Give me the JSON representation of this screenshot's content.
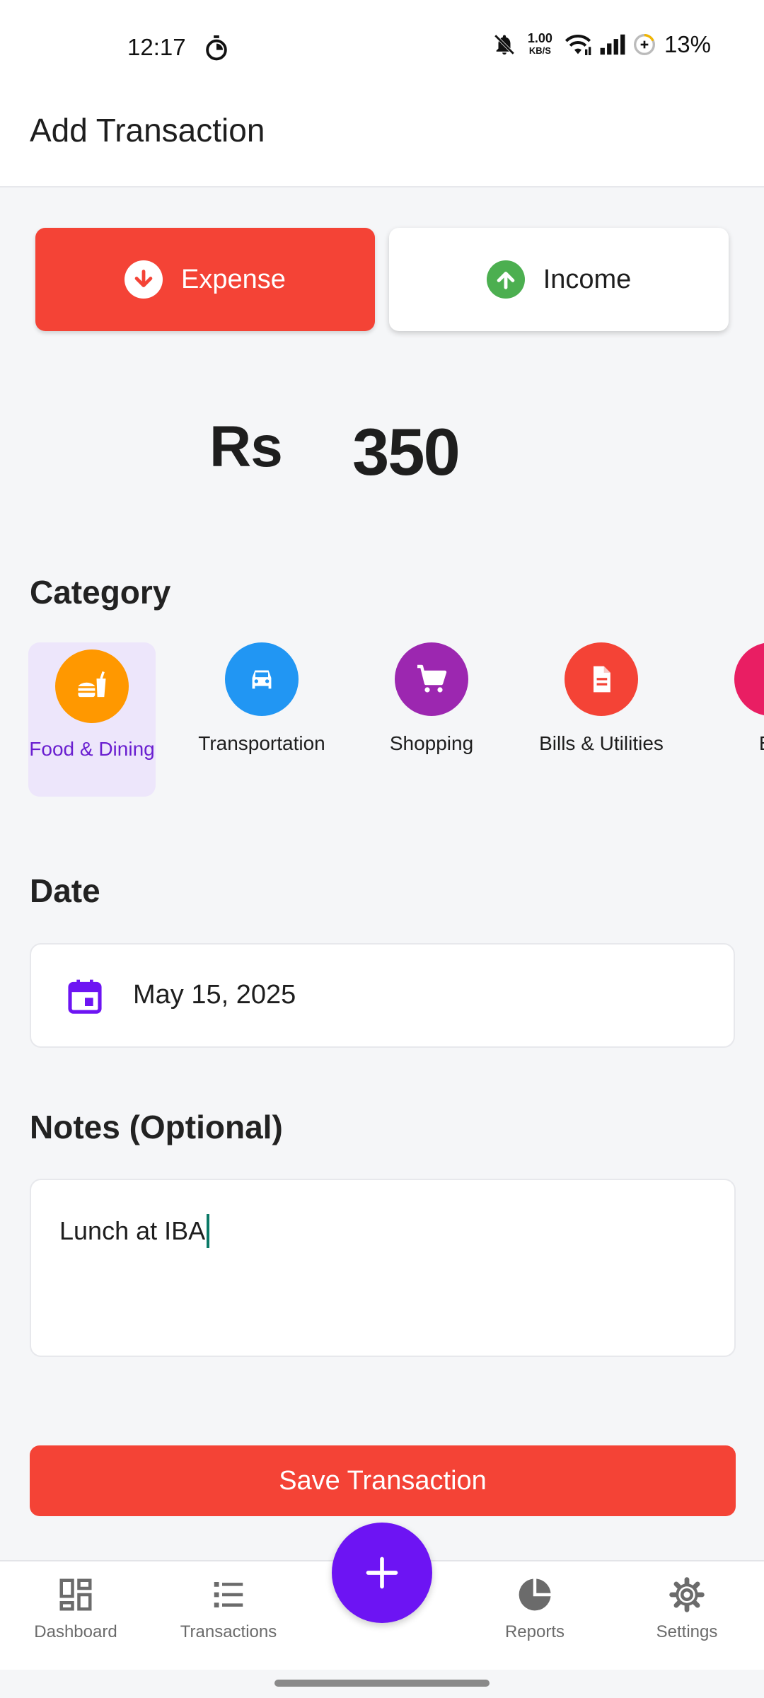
{
  "status_bar": {
    "time": "12:17",
    "net_speed_value": "1.00",
    "net_speed_unit": "KB/S",
    "battery": "13%",
    "icons": [
      "timer-icon",
      "bell-off-icon",
      "wifi-icon",
      "signal-icon",
      "battery-saver-icon"
    ]
  },
  "header": {
    "title": "Add Transaction"
  },
  "type_toggle": {
    "expense_label": "Expense",
    "income_label": "Income",
    "selected": "Expense"
  },
  "amount": {
    "currency": "Rs",
    "value": "350"
  },
  "category": {
    "title": "Category",
    "selected": "Food & Dining",
    "items": [
      {
        "label": "Food & Dining",
        "color": "#ff9800",
        "icon": "fastfood-icon"
      },
      {
        "label": "Transportation",
        "color": "#2196f3",
        "icon": "car-icon"
      },
      {
        "label": "Shopping",
        "color": "#9c27b0",
        "icon": "cart-icon"
      },
      {
        "label": "Bills & Utilities",
        "color": "#f44336",
        "icon": "receipt-icon"
      },
      {
        "label": "En",
        "color": "#e91e63",
        "icon": "entertainment-icon"
      }
    ]
  },
  "date": {
    "title": "Date",
    "value": "May 15, 2025"
  },
  "notes": {
    "title": "Notes (Optional)",
    "value": "Lunch at IBA"
  },
  "save_button": "Save Transaction",
  "bottom_nav": {
    "items": [
      {
        "label": "Dashboard",
        "icon": "dashboard-icon"
      },
      {
        "label": "Transactions",
        "icon": "list-icon"
      },
      {
        "label": "Reports",
        "icon": "pie-chart-icon"
      },
      {
        "label": "Settings",
        "icon": "gear-icon"
      }
    ],
    "fab_icon": "plus-icon"
  },
  "colors": {
    "expense": "#f44336",
    "income_icon": "#4caf50",
    "primary": "#6d14f3",
    "selected_category_bg": "#ede6fb",
    "selected_category_text": "#6a1fd0"
  }
}
